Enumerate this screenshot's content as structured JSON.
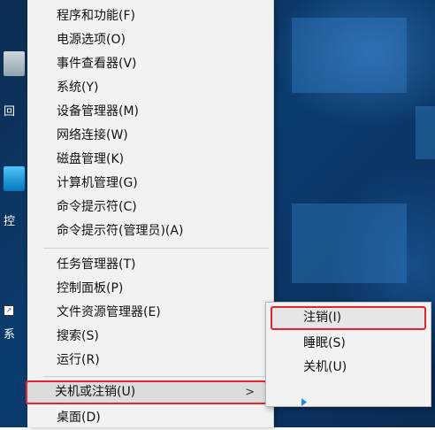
{
  "menu": {
    "items": [
      {
        "label": "程序和功能(F)"
      },
      {
        "label": "电源选项(O)"
      },
      {
        "label": "事件查看器(V)"
      },
      {
        "label": "系统(Y)"
      },
      {
        "label": "设备管理器(M)"
      },
      {
        "label": "网络连接(W)"
      },
      {
        "label": "磁盘管理(K)"
      },
      {
        "label": "计算机管理(G)"
      },
      {
        "label": "命令提示符(C)"
      },
      {
        "label": "命令提示符(管理员)(A)"
      },
      {
        "label": "任务管理器(T)"
      },
      {
        "label": "控制面板(P)"
      },
      {
        "label": "文件资源管理器(E)"
      },
      {
        "label": "搜索(S)"
      },
      {
        "label": "运行(R)"
      },
      {
        "label": "关机或注销(U)",
        "submenu_arrow": ">"
      },
      {
        "label": "桌面(D)"
      }
    ]
  },
  "submenu": {
    "items": [
      {
        "label": "注销(I)"
      },
      {
        "label": "睡眠(S)"
      },
      {
        "label": "关机(U)"
      }
    ]
  },
  "desktop": {
    "icons": [
      {
        "label": "回"
      },
      {
        "label": "控"
      },
      {
        "label": "系"
      }
    ]
  },
  "colors": {
    "highlight_box": "#e1262f",
    "menu_bg": "#f2f2f2",
    "desktop_bg": "#0b3c70"
  }
}
